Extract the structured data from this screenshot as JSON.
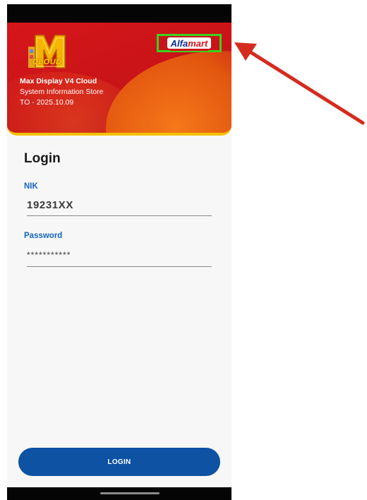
{
  "header": {
    "logo_text": "CLOUD",
    "brand_part1": "Alfa",
    "brand_part2": "mart",
    "app_title": "Max Display V4 Cloud",
    "app_subtitle": "System Information Store",
    "app_version": "TO - 2025.10.09"
  },
  "login": {
    "title": "Login",
    "nik_label": "NIK",
    "nik_value": "19231XX",
    "password_label": "Password",
    "password_value": "***********",
    "button_label": "LOGIN"
  },
  "colors": {
    "header_red": "#c81418",
    "accent_yellow": "#f2c200",
    "highlight_green": "#39d21f",
    "button_blue": "#0d52a3",
    "label_blue": "#1565c0",
    "annotation_arrow": "#d52b1e"
  }
}
